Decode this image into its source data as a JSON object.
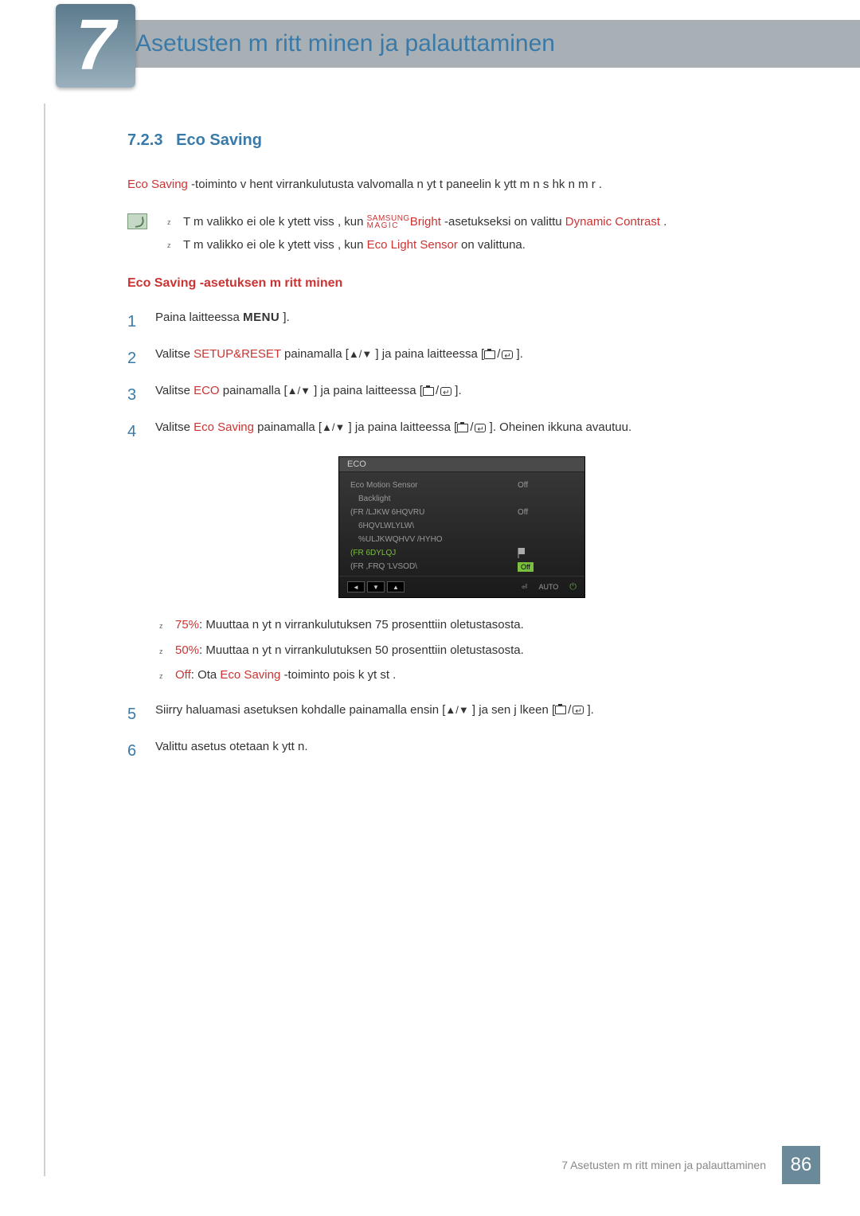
{
  "chapter": {
    "number": "7",
    "title": "Asetusten m  ritt minen ja palauttaminen"
  },
  "section": {
    "number": "7.2.3",
    "title": "Eco Saving"
  },
  "intro": {
    "feature": "Eco Saving",
    "desc": " -toiminto v hent   virrankulutusta valvomalla n yt t paneelin k ytt m n s hk n m  r  ."
  },
  "notes": {
    "item1_pre": "T m  valikko ei ole k ytett viss , kun  ",
    "item1_magic_top": "SAMSUNG",
    "item1_magic_bot": "MAGIC",
    "item1_bright": "Bright",
    "item1_post": " -asetukseksi on valittu ",
    "item1_dc": "Dynamic Contrast",
    "item1_end": " .",
    "item2_pre": "T m  valikko ei ole k ytett viss , kun  ",
    "item2_els": "Eco Light Sensor",
    "item2_end": "  on valittuna."
  },
  "subheading": "Eco Saving -asetuksen m  ritt minen",
  "steps": {
    "s1_pre": "Paina laitteessa ",
    "s1_menu": "MENU",
    "s1_post": "  ].",
    "s2_pre": "Valitse ",
    "s2_red": "SETUP&RESET",
    "s2_mid1": " painamalla [",
    "s2_keys": "▲/▼",
    "s2_mid2": " ] ja paina laitteessa  [",
    "s2_end": "  ].",
    "s3_pre": "Valitse ",
    "s3_red": "ECO",
    "s3_mid1": " painamalla [",
    "s3_mid2": " ] ja paina laitteessa [",
    "s3_end": "   ].",
    "s4_pre": "Valitse ",
    "s4_red": "Eco Saving",
    "s4_mid1": " painamalla [",
    "s4_mid2": " ] ja paina laitteessa [",
    "s4_end": "  ]. Oheinen ikkuna avautuu.",
    "s5_pre": "Siirry haluamasi asetuksen kohdalle painamalla ensin [",
    "s5_mid": "    ] ja sen j lkeen [",
    "s5_end": "    ].",
    "s6": "Valittu asetus otetaan k ytt  n."
  },
  "osd": {
    "title": "ECO",
    "r1_label": "Eco Motion Sensor",
    "r1_value": "Off",
    "r2_label": "Backlight",
    "r3_label": "(FR /LJKW 6HQVRU",
    "r3_value": "Off",
    "r4_label": "6HQVLWLYLW\\",
    "r5_label": "%ULJKWQHVV /HYHO",
    "r6_label": "(FR 6DYLQJ",
    "r7_label": "(FR ,FRQ 'LVSOD\\",
    "r7_value": "Off",
    "btn_left": "◄",
    "btn_down": "▼",
    "btn_up": "▲",
    "foot_enter": "⏎",
    "foot_auto": "AUTO",
    "foot_power": "⏻"
  },
  "values": {
    "v1_red": "75%",
    "v1_text": ": Muuttaa n yt n virrankulutuksen 75 prosenttiin oletustasosta.",
    "v2_red": "50%",
    "v2_text": ": Muuttaa n yt n virrankulutuksen 50 prosenttiin oletustasosta.",
    "v3_red": "Off",
    "v3_mid": ": Ota ",
    "v3_feat": "Eco Saving",
    "v3_end": " -toiminto pois k yt st ."
  },
  "footer": {
    "text": "7 Asetusten m  ritt minen ja palauttaminen",
    "page": "86"
  }
}
